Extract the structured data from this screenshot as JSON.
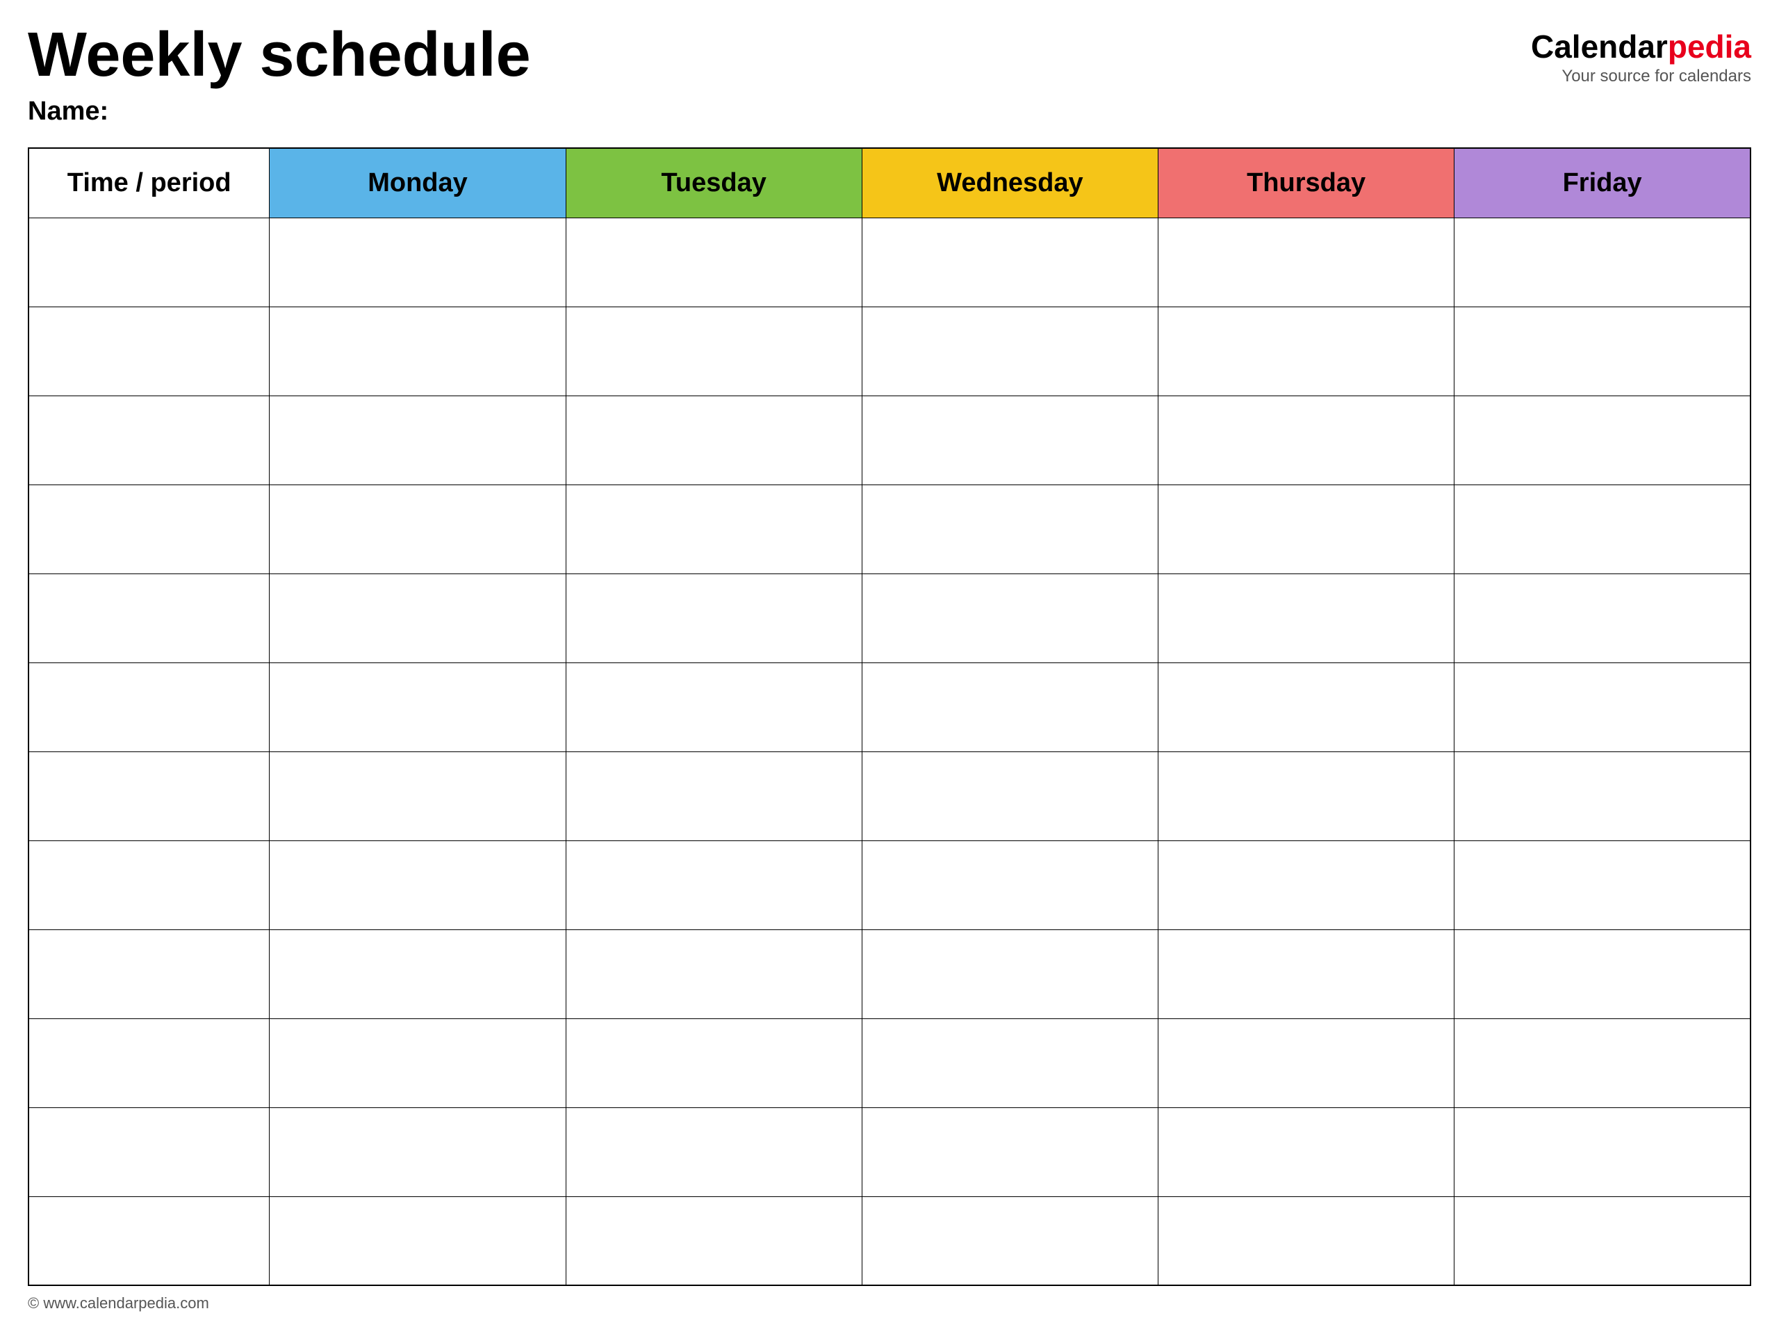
{
  "header": {
    "title": "Weekly schedule",
    "name_label": "Name:",
    "logo": {
      "calendar_part": "Calendar",
      "pedia_part": "pedia",
      "tagline": "Your source for calendars"
    }
  },
  "table": {
    "columns": [
      {
        "id": "time",
        "label": "Time / period",
        "color": "#ffffff"
      },
      {
        "id": "monday",
        "label": "Monday",
        "color": "#5ab4e8"
      },
      {
        "id": "tuesday",
        "label": "Tuesday",
        "color": "#7dc242"
      },
      {
        "id": "wednesday",
        "label": "Wednesday",
        "color": "#f5c518"
      },
      {
        "id": "thursday",
        "label": "Thursday",
        "color": "#f07070"
      },
      {
        "id": "friday",
        "label": "Friday",
        "color": "#b088d8"
      }
    ],
    "row_count": 12
  },
  "footer": {
    "url": "© www.calendarpedia.com"
  }
}
